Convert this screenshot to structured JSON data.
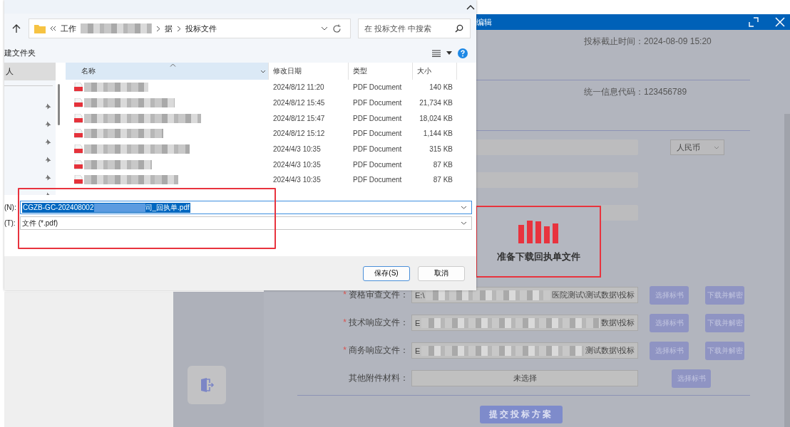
{
  "modal": {
    "title": "编辑",
    "deadline": "投标截止时间：2024-08-09 15:20",
    "credit_code": "统一信息代码：123456789",
    "currency": "人民币",
    "loading": {
      "text": "准备下载回执单文件"
    },
    "files": [
      {
        "marker": "*",
        "label": "资格审查文件：",
        "value_start": "E:\\",
        "value_end": "医院测试\\测试数据\\投标",
        "buttons": [
          "选择标书",
          "下载并解密"
        ]
      },
      {
        "marker": "*",
        "label": "技术响应文件：",
        "value_start": "E",
        "value_end": "数据\\投标",
        "buttons": [
          "选择标书",
          "下载并解密"
        ]
      },
      {
        "marker": "*",
        "label": "商务响应文件：",
        "value_start": "E",
        "value_end": "测试数据\\投标",
        "buttons": [
          "选择标书",
          "下载并解密"
        ]
      },
      {
        "label": "其他附件材料：",
        "value": "未选择",
        "buttons": [
          "选择标书"
        ]
      }
    ],
    "submit": "提交投标方案"
  },
  "dialog": {
    "path": [
      "工作",
      "据",
      "投标文件"
    ],
    "search": {
      "placeholder": "在 投标文件 中搜索"
    },
    "new_folder": "建文件夹",
    "nav": [
      {
        "label": "人",
        "selected": true
      }
    ],
    "columns": [
      "名称",
      "修改日期",
      "类型",
      "大小"
    ],
    "rows": [
      {
        "date": "2024/8/12 11:20",
        "type": "PDF Document",
        "size": "140 KB"
      },
      {
        "date": "2024/8/12 15:45",
        "type": "PDF Document",
        "size": "21,734 KB"
      },
      {
        "date": "2024/8/12 15:47",
        "type": "PDF Document",
        "size": "18,024 KB"
      },
      {
        "date": "2024/8/12 15:12",
        "type": "PDF Document",
        "size": "1,144 KB"
      },
      {
        "date": "2024/4/3 10:35",
        "type": "PDF Document",
        "size": "315 KB"
      },
      {
        "date": "2024/4/3 10:35",
        "type": "PDF Document",
        "size": "87 KB"
      },
      {
        "date": "2024/4/3 10:35",
        "type": "PDF Document",
        "size": "87 KB"
      }
    ],
    "filename": {
      "label": "(N):",
      "value_start": "CGZB-GC-202408002",
      "value_end": "司_回执单.pdf"
    },
    "filetype": {
      "label": "(T):",
      "value": "文件 (*.pdf)"
    },
    "buttons": [
      {
        "label": "保存(S)",
        "default": true
      },
      {
        "label": "取消",
        "default": false
      }
    ]
  }
}
